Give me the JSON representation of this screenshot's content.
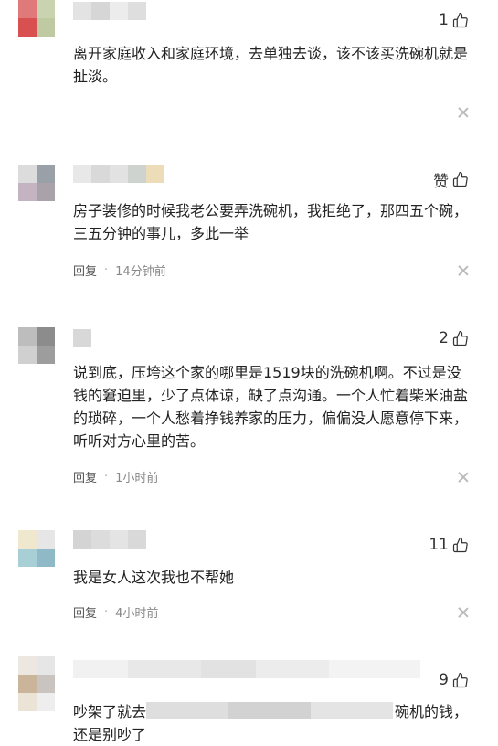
{
  "comments": [
    {
      "id": "c1",
      "like_label": "1",
      "text": "离开家庭收入和家庭环境，去单独去谈，该不该买洗碗机就是扯淡。",
      "reply_label": "",
      "time": ""
    },
    {
      "id": "c2",
      "like_label": "赞",
      "text": "房子装修的时候我老公要弄洗碗机，我拒绝了，那四五个碗，三五分钟的事儿，多此一举",
      "reply_label": "回复",
      "time": "14分钟前"
    },
    {
      "id": "c3",
      "like_label": "2",
      "text": "说到底，压垮这个家的哪里是1519块的洗碗机啊。不过是没钱的窘迫里，少了点体谅，缺了点沟通。一个人忙着柴米油盐的琐碎，一个人愁着挣钱养家的压力，偏偏没人愿意停下来，听听对方心里的苦。",
      "reply_label": "回复",
      "time": "1小时前"
    },
    {
      "id": "c4",
      "like_label": "11",
      "text": "我是女人这次我也不帮她",
      "reply_label": "回复",
      "time": "4小时前"
    },
    {
      "id": "c5",
      "like_label": "9",
      "text_start": "吵架了就去",
      "text_end": "碗机的钱，",
      "text_line2": "还是别吵了",
      "reply_label": "",
      "time": ""
    }
  ],
  "meta": {
    "separator": "·"
  },
  "icons": {
    "like": "thumbs-up-icon",
    "close": "close-icon"
  },
  "colors": {
    "text": "#222222",
    "meta": "#888888",
    "blur_light": "#e6e6e6"
  }
}
